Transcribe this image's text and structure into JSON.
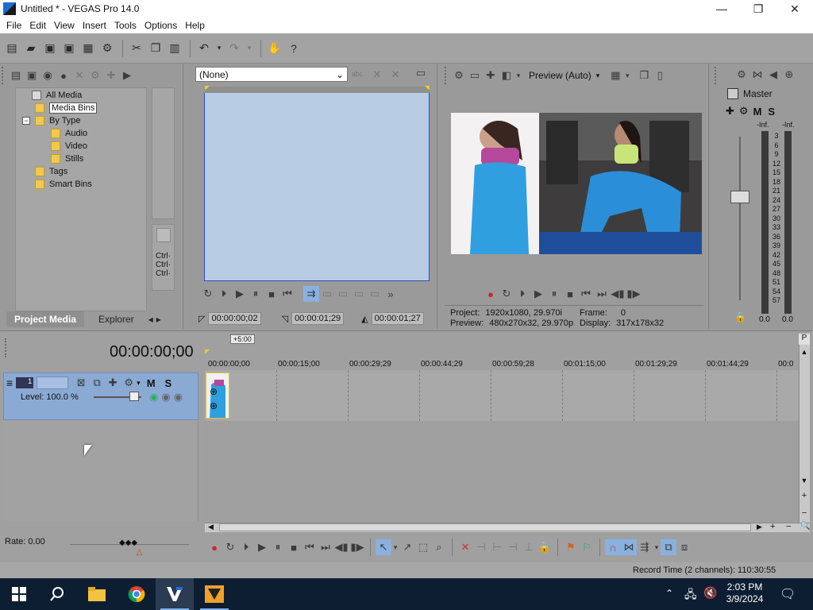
{
  "window": {
    "title": "Untitled * - VEGAS Pro 14.0"
  },
  "menu": [
    "File",
    "Edit",
    "View",
    "Insert",
    "Tools",
    "Options",
    "Help"
  ],
  "project_media": {
    "tree": {
      "all_media": "All Media",
      "media_bins": "Media Bins",
      "by_type": "By Type",
      "audio": "Audio",
      "video": "Video",
      "stills": "Stills",
      "tags": "Tags",
      "smart_bins": "Smart Bins",
      "expander": "−"
    },
    "tabs": {
      "project_media": "Project Media",
      "explorer": "Explorer"
    },
    "ctrl_labels": [
      "Ctrl·",
      "Ctrl·",
      "Ctrl·"
    ]
  },
  "trimmer": {
    "dropdown": "(None)",
    "tc_in": "00:00:00;02",
    "tc_out": "00:00:01;29",
    "tc_len": "00:00:01;27"
  },
  "preview": {
    "mode": "Preview (Auto)",
    "project_label": "Project:",
    "project_value": "1920x1080, 29.970i",
    "preview_label": "Preview:",
    "preview_value": "480x270x32, 29.970p",
    "frame_label": "Frame:",
    "frame_value": "0",
    "display_label": "Display:",
    "display_value": "317x178x32"
  },
  "mixer": {
    "title": "Master",
    "m": "M",
    "s": "S",
    "inf_left": "-Inf.",
    "inf_right": "-Inf.",
    "scale": [
      "3",
      "6",
      "9",
      "12",
      "15",
      "18",
      "21",
      "24",
      "27",
      "30",
      "33",
      "36",
      "39",
      "42",
      "45",
      "48",
      "51",
      "54",
      "57"
    ],
    "level_left": "0.0",
    "level_right": "0.0"
  },
  "timeline": {
    "timecode": "00:00:00;00",
    "offset_badge": "+5:00",
    "ruler": [
      "00:00:00;00",
      "00:00:15;00",
      "00:00:29;29",
      "00:00:44;29",
      "00:00:59;28",
      "00:01:15;00",
      "00:01:29;29",
      "00:01:44;29",
      "00:0"
    ],
    "track": {
      "number": "1",
      "level": "Level: 100.0 %",
      "m": "M",
      "s": "S"
    },
    "rate": "Rate: 0.00"
  },
  "status": {
    "record_time": "Record Time (2 channels): 110:30:55"
  },
  "taskbar": {
    "time": "2:03 PM",
    "date": "3/9/2024"
  },
  "colors": {
    "track_header": "#8aaad3",
    "trimmer_bg": "#b8cce4",
    "taskbar": "#0d1e33",
    "record": "#d0262b"
  }
}
